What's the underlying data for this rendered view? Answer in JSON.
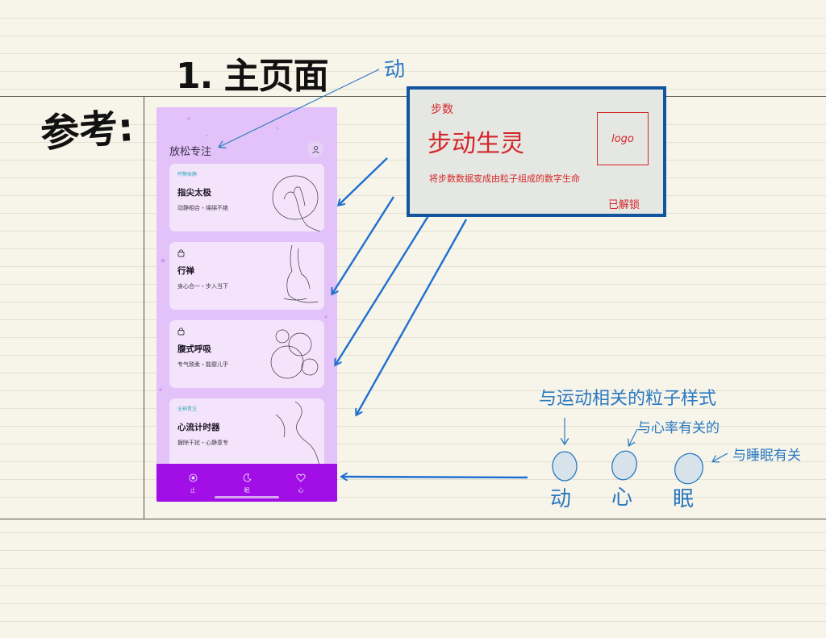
{
  "page": {
    "title": "1. 主页面",
    "reference_label": "参考:",
    "annotation_dong": "动"
  },
  "phone": {
    "header_title": "放松专注",
    "cards": [
      {
        "tag": "呼静体静",
        "title": "指尖太极",
        "subtitle": "动静相合・绵绵不绝",
        "locked": false
      },
      {
        "tag": "",
        "title": "行禅",
        "subtitle": "身心合一・步入当下",
        "locked": true
      },
      {
        "tag": "",
        "title": "腹式呼吸",
        "subtitle": "专气致柔・能婴儿乎",
        "locked": true
      },
      {
        "tag": "全神贯注",
        "title": "心流计时器",
        "subtitle": "摒除干扰・心静意专",
        "locked": false
      }
    ],
    "nav": [
      {
        "label": "止",
        "icon": "target-icon"
      },
      {
        "label": "眠",
        "icon": "moon-icon"
      },
      {
        "label": "心",
        "icon": "heart-icon"
      }
    ],
    "colors": {
      "background": "#e2c2f8",
      "card": "#f3e4fb",
      "bottom_bar": "#a10ee6",
      "tag": "#30a8b7"
    }
  },
  "notes": {
    "box_label": "步数",
    "brand": "步动生灵",
    "description": "将步数数据变成由粒子组成的数字生命",
    "logo": "logo",
    "status": "已解锁",
    "colors": {
      "border": "#12559f",
      "ink": "#d6262a"
    }
  },
  "particles": {
    "heading": "与运动相关的粒子样式",
    "heart_note": "与心率有关的",
    "sleep_note": "与睡眠有关",
    "items": [
      {
        "label": "动"
      },
      {
        "label": "心"
      },
      {
        "label": "眠"
      }
    ],
    "ink_color": "#2a79c2"
  }
}
